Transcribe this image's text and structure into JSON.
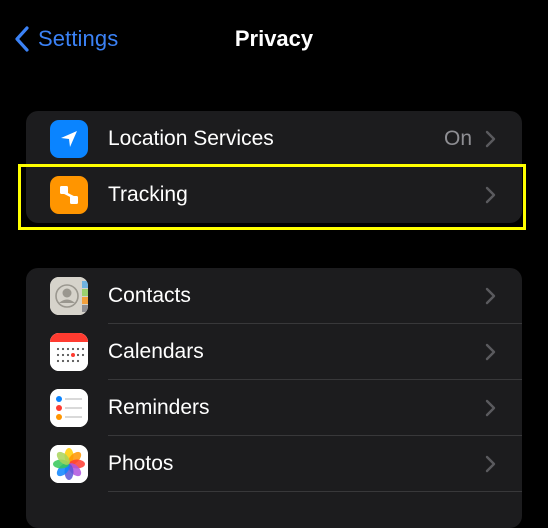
{
  "nav": {
    "back_label": "Settings",
    "title": "Privacy"
  },
  "group1": [
    {
      "label": "Location Services",
      "value": "On",
      "icon": "location-arrow-icon",
      "icon_bg": "#0a84ff"
    },
    {
      "label": "Tracking",
      "value": "",
      "icon": "tracking-icon",
      "icon_bg": "#ff9500"
    }
  ],
  "group2": [
    {
      "label": "Contacts",
      "icon": "contacts-icon"
    },
    {
      "label": "Calendars",
      "icon": "calendar-icon"
    },
    {
      "label": "Reminders",
      "icon": "reminders-icon"
    },
    {
      "label": "Photos",
      "icon": "photos-icon"
    }
  ],
  "colors": {
    "accent": "#3b82f6",
    "highlight": "#ffff00",
    "background": "#000000",
    "cell": "#1c1c1e",
    "secondary_text": "#8e8e93"
  }
}
